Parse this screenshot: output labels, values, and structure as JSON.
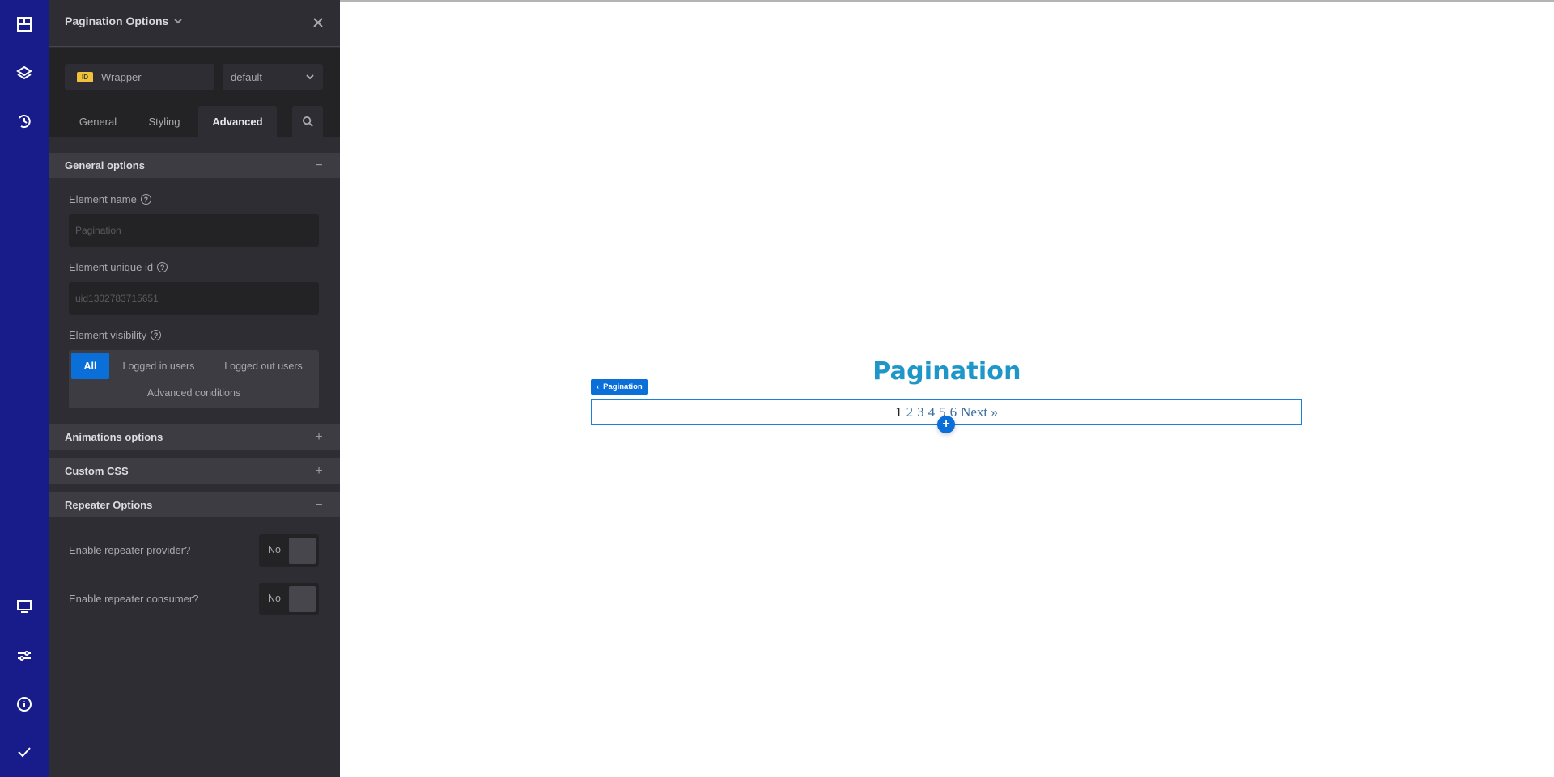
{
  "rail": {
    "top_icons": [
      "layout-icon",
      "layers-icon",
      "history-icon"
    ],
    "bottom_icons": [
      "monitor-icon",
      "sliders-icon",
      "info-icon",
      "check-icon"
    ]
  },
  "panel": {
    "title": "Pagination Options",
    "wrapper": {
      "badge": "ID",
      "value": "Wrapper"
    },
    "preset": {
      "selected": "default"
    },
    "tabs": [
      {
        "label": "General",
        "active": false
      },
      {
        "label": "Styling",
        "active": false
      },
      {
        "label": "Advanced",
        "active": true
      }
    ],
    "sections": {
      "general": {
        "title": "General options",
        "toggle": "−",
        "element_name": {
          "label": "Element name",
          "placeholder": "Pagination",
          "value": ""
        },
        "element_id": {
          "label": "Element unique id",
          "placeholder": "uid1302783715651",
          "value": ""
        },
        "visibility": {
          "label": "Element visibility",
          "options": [
            "All",
            "Logged in users",
            "Logged out users",
            "Advanced conditions"
          ],
          "selected": "All"
        }
      },
      "animations": {
        "title": "Animations options",
        "toggle": "+"
      },
      "custom_css": {
        "title": "Custom CSS",
        "toggle": "+"
      },
      "repeater": {
        "title": "Repeater Options",
        "toggle": "−",
        "provider": {
          "label": "Enable repeater provider?",
          "value": "No"
        },
        "consumer": {
          "label": "Enable repeater consumer?",
          "value": "No"
        }
      }
    },
    "help_glyph": "?"
  },
  "canvas": {
    "heading": "Pagination",
    "element_tag": "Pagination",
    "element_tag_arrow": "‹",
    "pager": {
      "current": "1",
      "pages": [
        "2",
        "3",
        "4",
        "5",
        "6"
      ],
      "next": "Next »"
    },
    "add_glyph": "+"
  },
  "colors": {
    "rail": "#171c8a",
    "panel": "#2d2d33",
    "accent": "#0a6fd8",
    "heading": "#1e96c8",
    "id_badge": "#f0c23a"
  }
}
